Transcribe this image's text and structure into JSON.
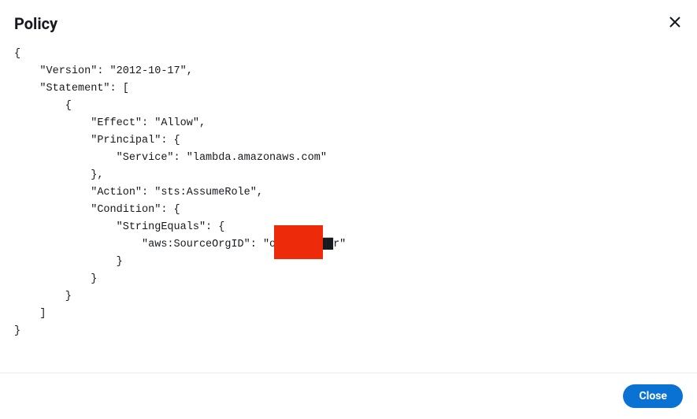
{
  "modal": {
    "title": "Policy",
    "close_button": "Close"
  },
  "policy": {
    "line1": "{",
    "line2": "    \"Version\": \"2012-10-17\",",
    "line3": "    \"Statement\": [",
    "line4": "        {",
    "line5": "            \"Effect\": \"Allow\",",
    "line6": "            \"Principal\": {",
    "line7": "                \"Service\": \"lambda.amazonaws.com\"",
    "line8": "            },",
    "line9": "            \"Action\": \"sts:AssumeRole\",",
    "line10": "            \"Condition\": {",
    "line11": "                \"StringEquals\": {",
    "line12": "                    \"aws:SourceOrgID\": \"o-d███████r\"",
    "line13": "                }",
    "line14": "            }",
    "line15": "        }",
    "line16": "    ]",
    "line17": "}"
  }
}
